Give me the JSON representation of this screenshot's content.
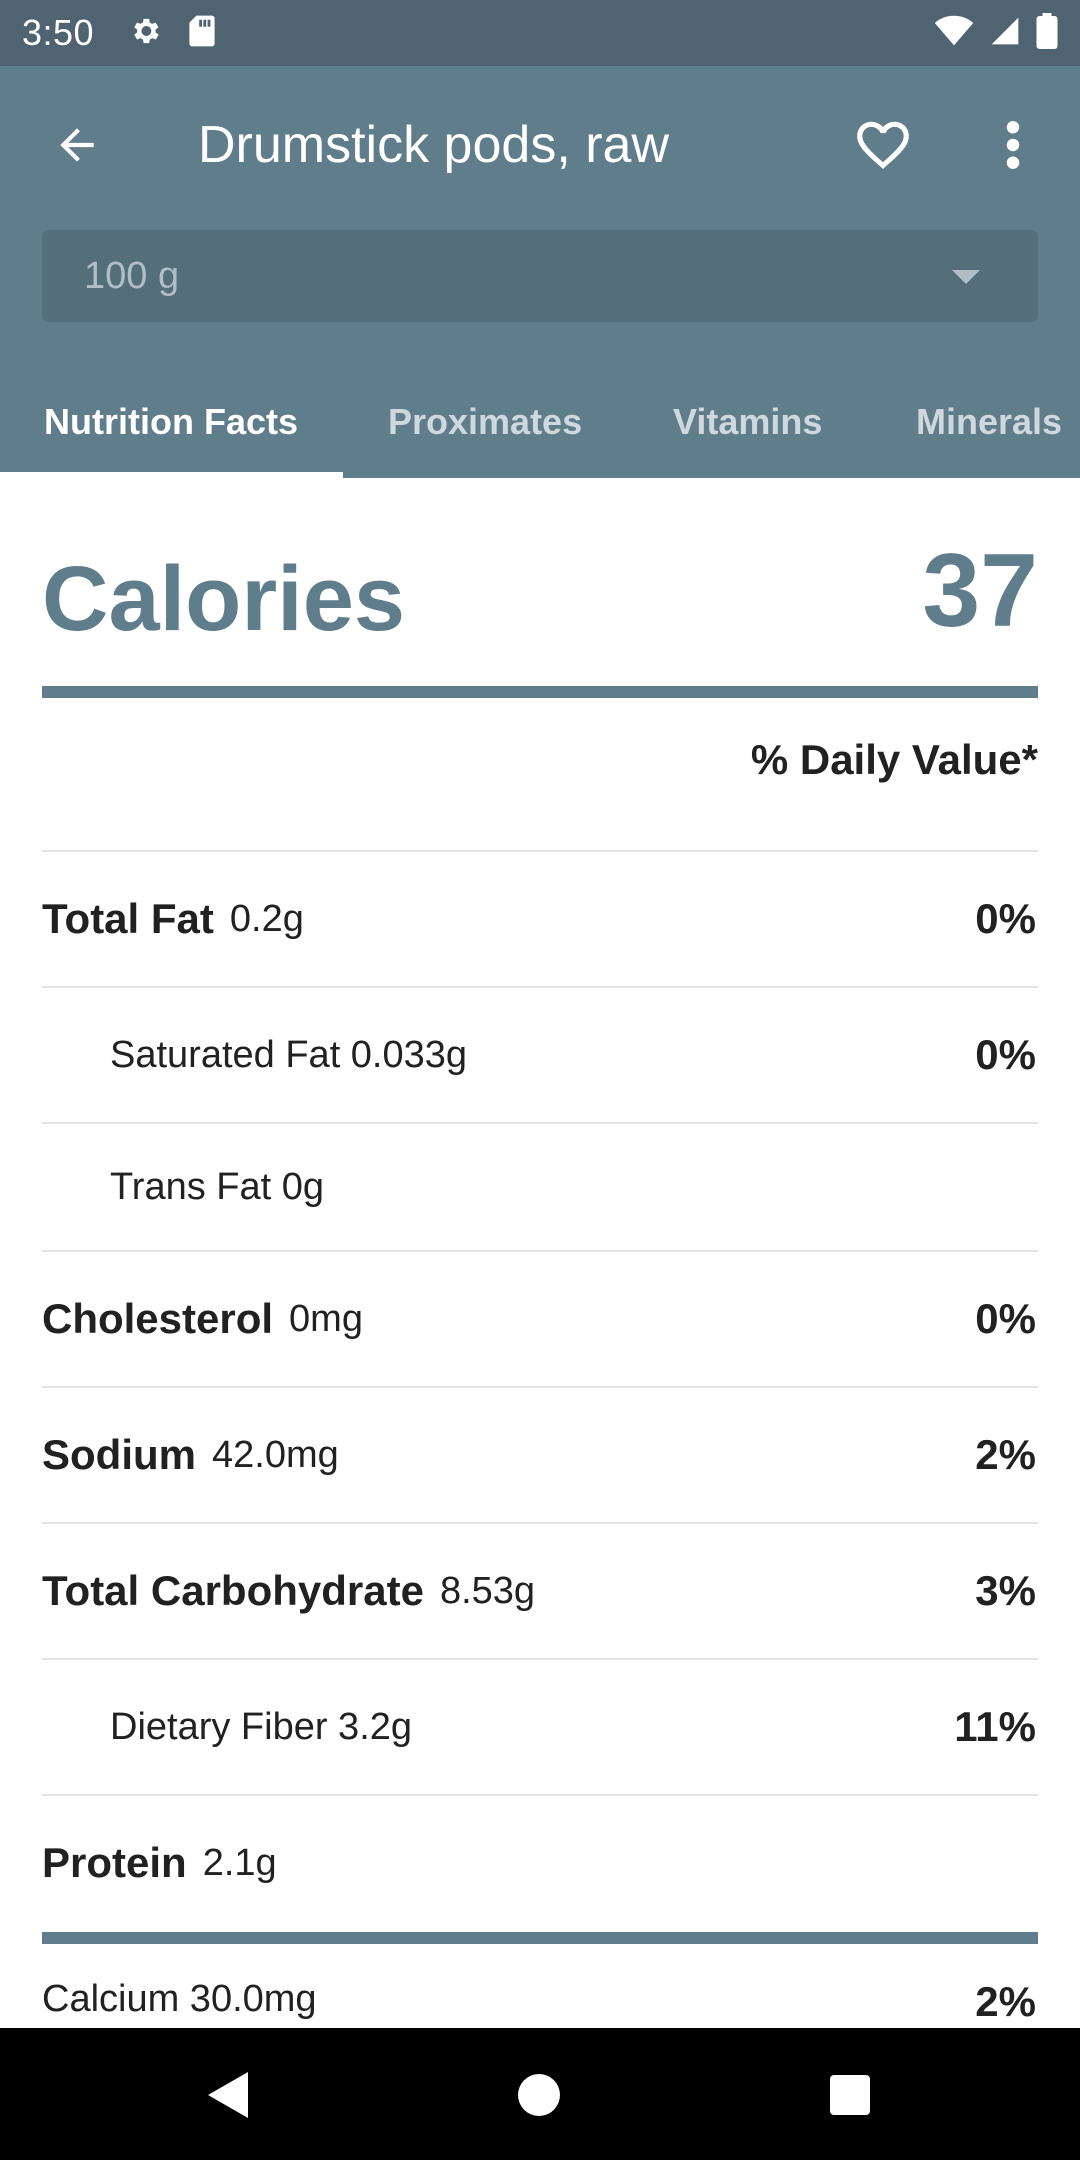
{
  "status_bar": {
    "time": "3:50",
    "icons": [
      "gear-icon",
      "sd-card-icon",
      "wifi-icon",
      "signal-icon",
      "battery-icon"
    ]
  },
  "app_bar": {
    "title": "Drumstick pods, raw",
    "back_icon": "arrow-left-icon",
    "favorite_icon": "heart-outline-icon",
    "more_icon": "more-vert-icon",
    "serving": {
      "selected": "100 g"
    },
    "tabs": [
      {
        "label": "Nutrition Facts",
        "active": true
      },
      {
        "label": "Proximates",
        "active": false
      },
      {
        "label": "Vitamins",
        "active": false
      },
      {
        "label": "Minerals",
        "active": false
      }
    ]
  },
  "nutrition": {
    "calories_label": "Calories",
    "calories_value": "37",
    "dv_header": "% Daily Value*",
    "rows": [
      {
        "name": "Total Fat",
        "amount": "0.2g",
        "dv": "0%"
      },
      {
        "sub": "Saturated Fat 0.033g",
        "dv": "0%"
      },
      {
        "sub": "Trans Fat 0g",
        "dv": ""
      },
      {
        "name": "Cholesterol",
        "amount": "0mg",
        "dv": "0%"
      },
      {
        "name": "Sodium",
        "amount": "42.0mg",
        "dv": "2%"
      },
      {
        "name": "Total Carbohydrate",
        "amount": "8.53g",
        "dv": "3%"
      },
      {
        "sub": "Dietary Fiber 3.2g",
        "dv": "11%"
      },
      {
        "name": "Protein",
        "amount": "2.1g",
        "dv": ""
      }
    ],
    "minerals": [
      {
        "sub": "Calcium 30.0mg",
        "dv": "2%"
      }
    ]
  },
  "colors": {
    "primary": "#607d8b",
    "primary_dark": "#4f6470",
    "select_bg": "#546e7a"
  }
}
